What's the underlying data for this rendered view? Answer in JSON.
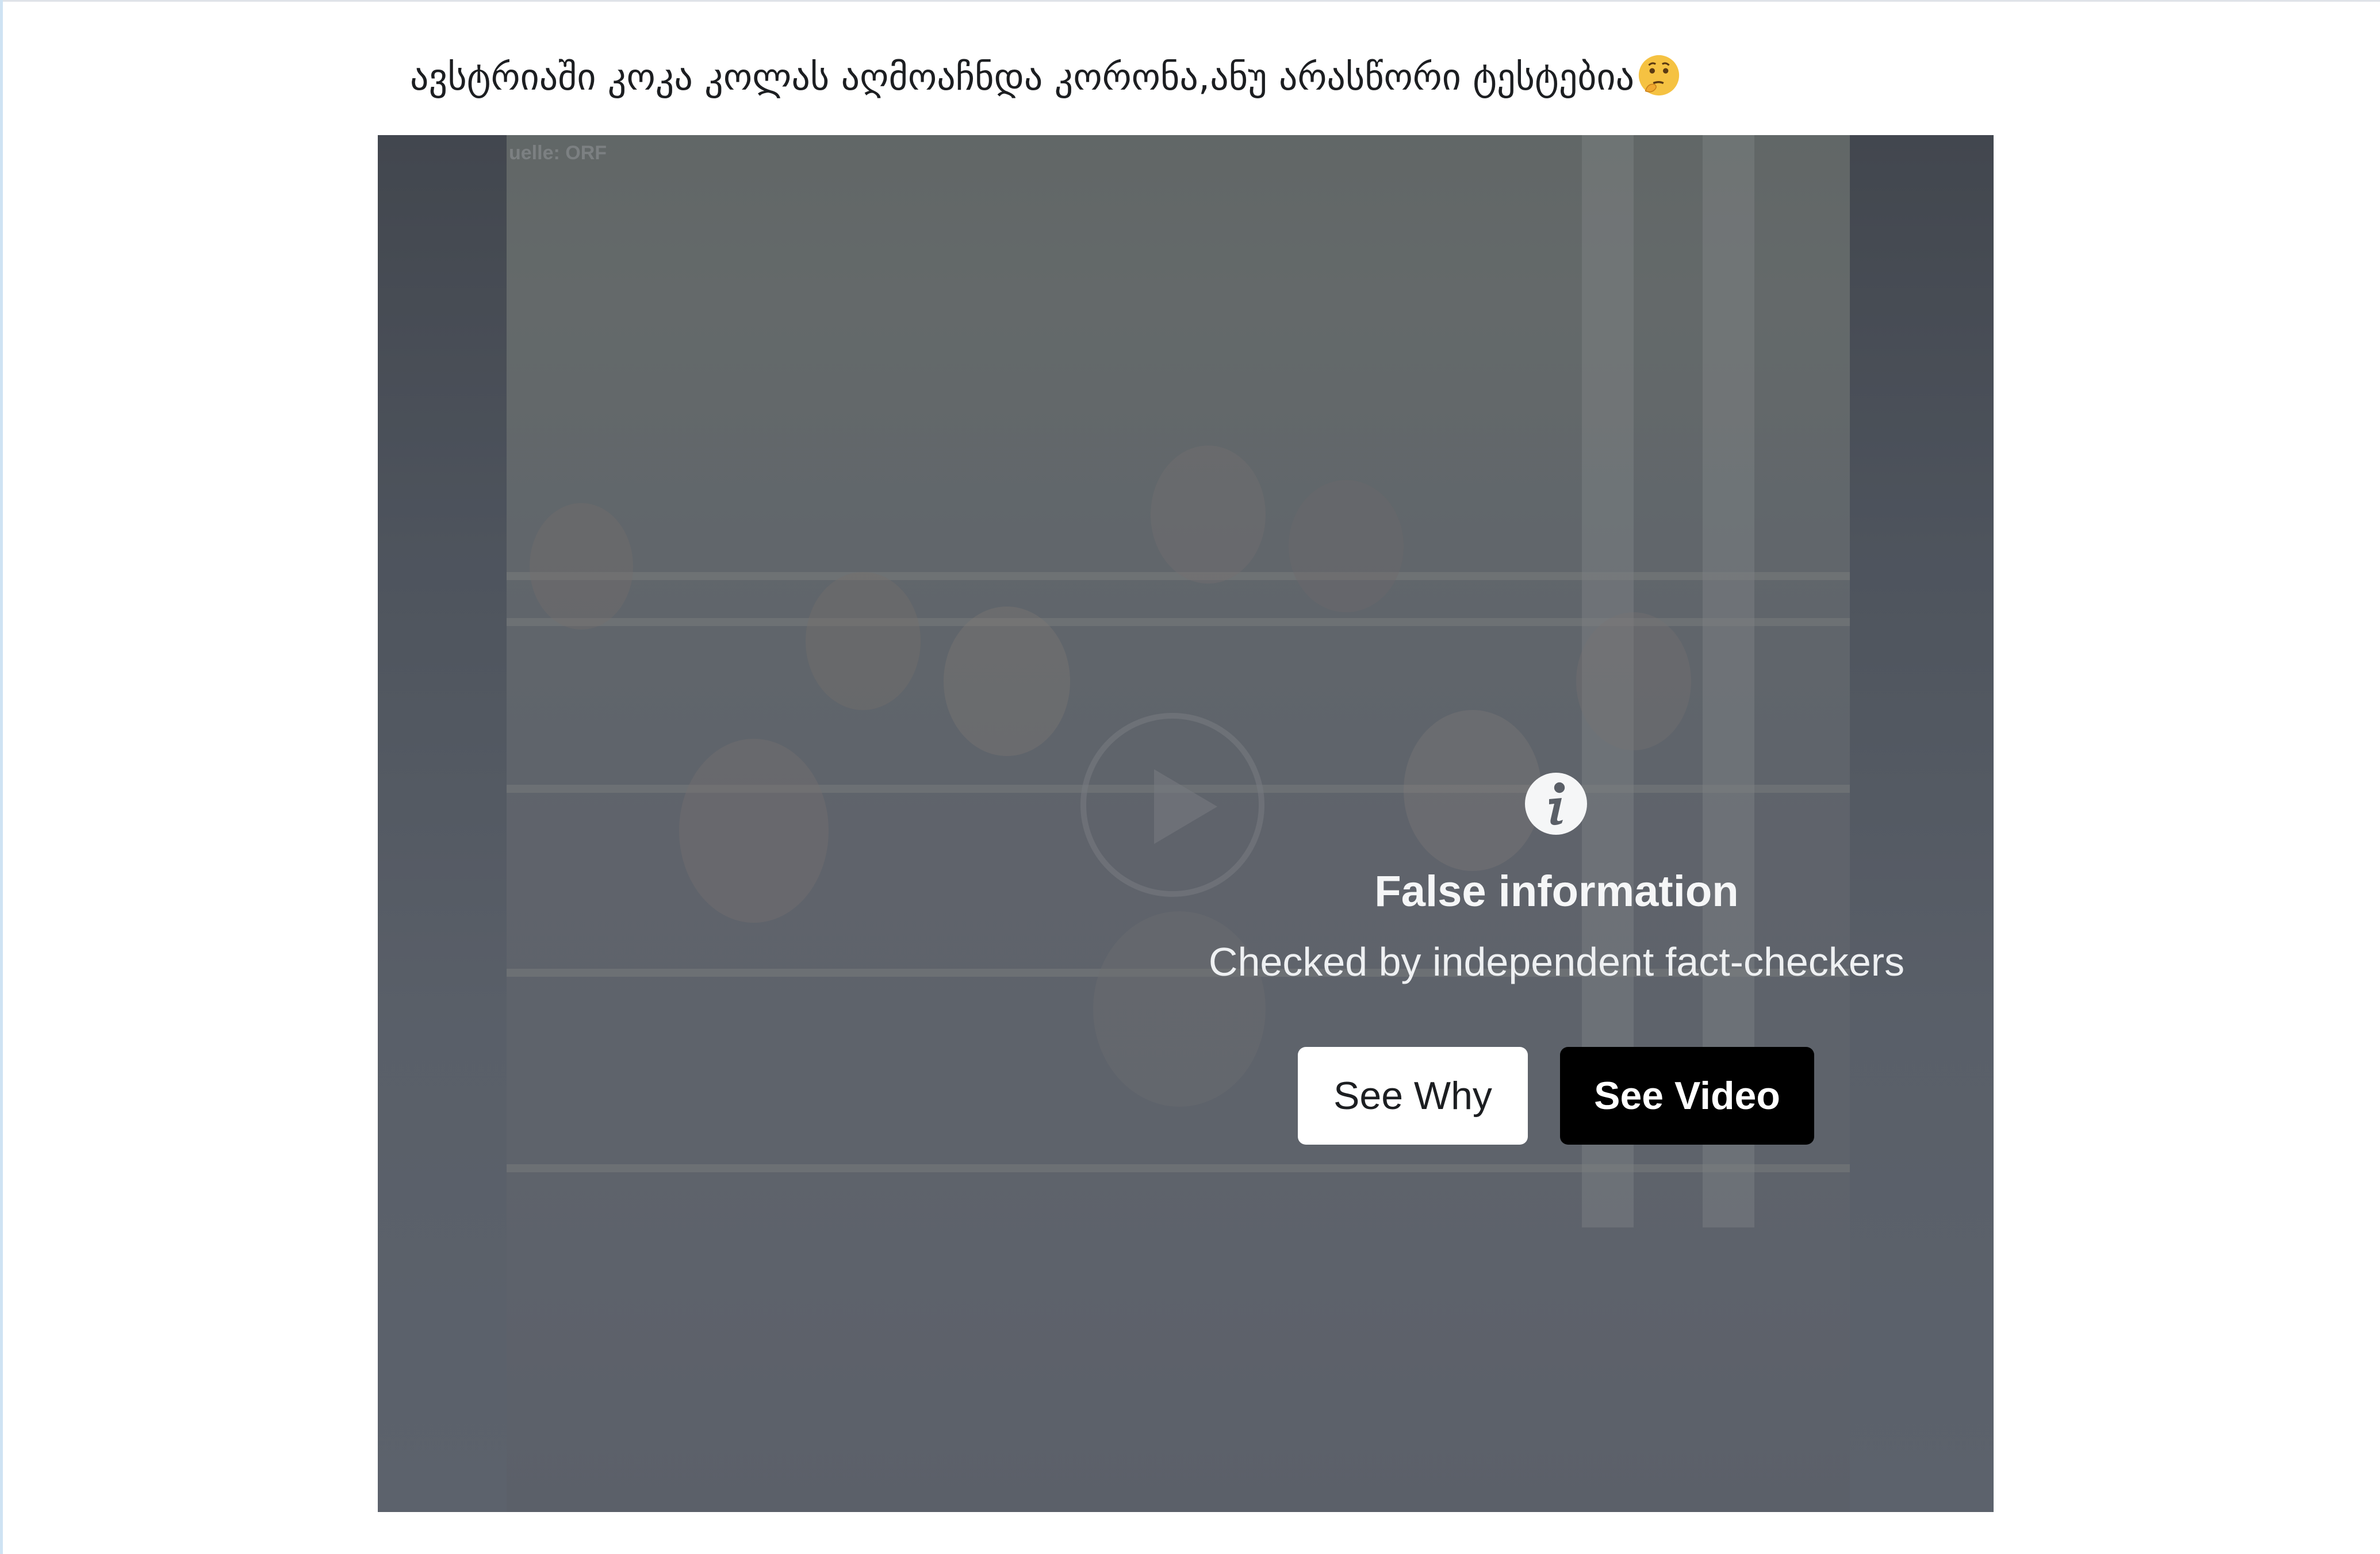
{
  "post": {
    "text": "ავსტრიაში კოკა კოლას აღმოაჩნდა კორონა,ანუ არასწორი ტესტებია",
    "emoji": "thinking-face-emoji"
  },
  "video": {
    "watermark": "uelle: ORF",
    "warning": {
      "icon": "info-icon",
      "title": "False information",
      "subtitle": "Checked by independent fact-checkers"
    },
    "buttons": {
      "see_why": "See Why",
      "see_video": "See Video"
    }
  },
  "colors": {
    "overlay": "#505660",
    "see_why_bg": "#ffffff",
    "see_video_bg": "#000000",
    "text_primary": "#1c1e21"
  }
}
